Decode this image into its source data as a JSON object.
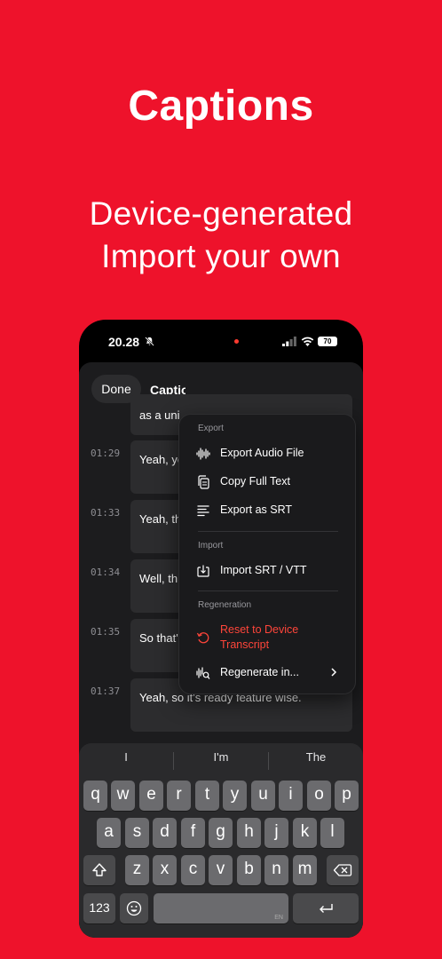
{
  "hero": {
    "title": "Captions",
    "subtitle_line1": "Device-generated",
    "subtitle_line2": "Import your own"
  },
  "status_bar": {
    "time": "20.28",
    "battery": "70"
  },
  "sheet": {
    "done_label": "Done",
    "title": "Captions",
    "rows": [
      {
        "time": "",
        "text": "as a uni"
      },
      {
        "time": "01:29",
        "text": "Yeah, yo"
      },
      {
        "time": "01:33",
        "text": "Yeah, th"
      },
      {
        "time": "01:34",
        "text": "Well, thi"
      },
      {
        "time": "01:35",
        "text": "So that's"
      },
      {
        "time": "01:37",
        "text": "Yeah, so it's ready feature wise."
      }
    ]
  },
  "menu": {
    "export_header": "Export",
    "export_audio": "Export Audio File",
    "copy_text": "Copy Full Text",
    "export_srt": "Export as SRT",
    "import_header": "Import",
    "import_srt": "Import SRT / VTT",
    "regen_header": "Regeneration",
    "reset_line1": "Reset to Device",
    "reset_line2": "Transcript",
    "regenerate": "Regenerate in..."
  },
  "keyboard": {
    "suggestions": [
      "I",
      "I'm",
      "The"
    ],
    "row1": [
      "q",
      "w",
      "e",
      "r",
      "t",
      "y",
      "u",
      "i",
      "o",
      "p"
    ],
    "row2": [
      "a",
      "s",
      "d",
      "f",
      "g",
      "h",
      "j",
      "k",
      "l"
    ],
    "row3": [
      "z",
      "x",
      "c",
      "v",
      "b",
      "n",
      "m"
    ],
    "numbers_label": "123",
    "space_lang": "EN"
  },
  "colors": {
    "brand_red": "#EE122B",
    "destructive": "#FF453A"
  }
}
